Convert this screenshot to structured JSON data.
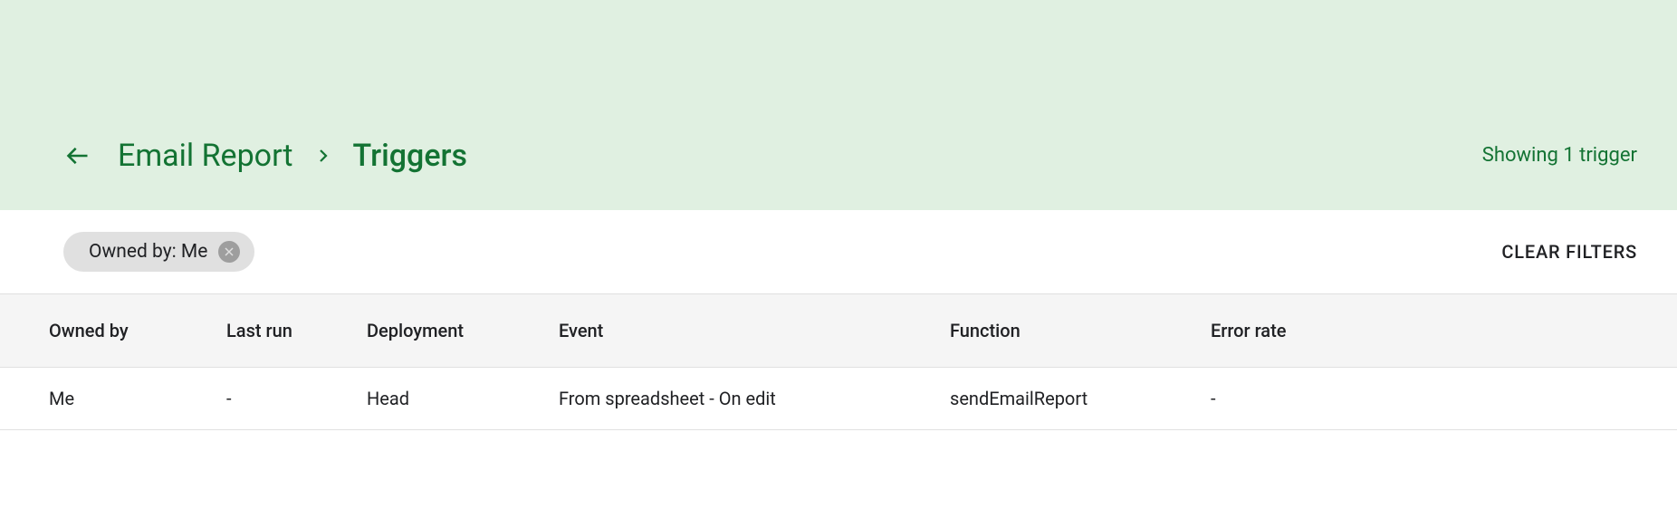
{
  "header": {
    "breadcrumb_project": "Email Report",
    "breadcrumb_current": "Triggers",
    "status_text": "Showing 1 trigger"
  },
  "filters": {
    "chip_label": "Owned by: Me",
    "clear_label": "CLEAR FILTERS"
  },
  "table": {
    "columns": {
      "owned_by": "Owned by",
      "last_run": "Last run",
      "deployment": "Deployment",
      "event": "Event",
      "function": "Function",
      "error_rate": "Error rate"
    },
    "rows": [
      {
        "owned_by": "Me",
        "last_run": "-",
        "deployment": "Head",
        "event": "From spreadsheet - On edit",
        "function": "sendEmailReport",
        "error_rate": "-"
      }
    ]
  }
}
